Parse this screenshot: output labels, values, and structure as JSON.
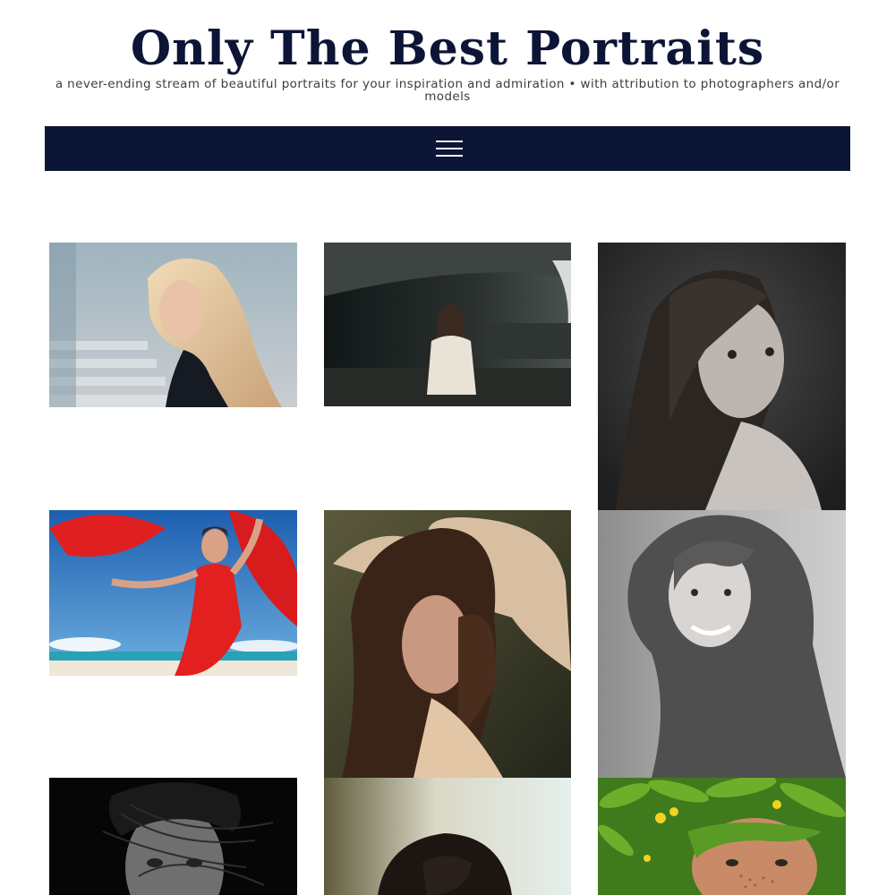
{
  "header": {
    "site_title": "Only The Best Portraits",
    "tagline": "a never-ending stream of beautiful portraits for your inspiration and admiration • with attribution to photographers and/or models"
  },
  "nav": {
    "menu_icon": "hamburger-menu-icon",
    "background": "#0c1536"
  },
  "gallery": {
    "photos": [
      {
        "subject": "blonde woman in black turtleneck by concrete steps"
      },
      {
        "subject": "woman in white blouse under dark concrete overpass"
      },
      {
        "subject": "black and white portrait of woman with long hair looking over shoulder"
      },
      {
        "subject": "woman in red dress with red fabric on a beach"
      },
      {
        "subject": "woman with hands in long brown hair, profile view"
      },
      {
        "subject": "black and white portrait of smiling woman with wavy hair"
      },
      {
        "subject": "black and white portrait with hair blowing across face"
      },
      {
        "subject": "dark-haired woman against pale background"
      },
      {
        "subject": "freckled woman lying among green leaves and yellow flowers"
      }
    ]
  },
  "colors": {
    "title": "#0c1536",
    "nav_bar": "#0c1536",
    "tagline": "#3d3d3d"
  }
}
